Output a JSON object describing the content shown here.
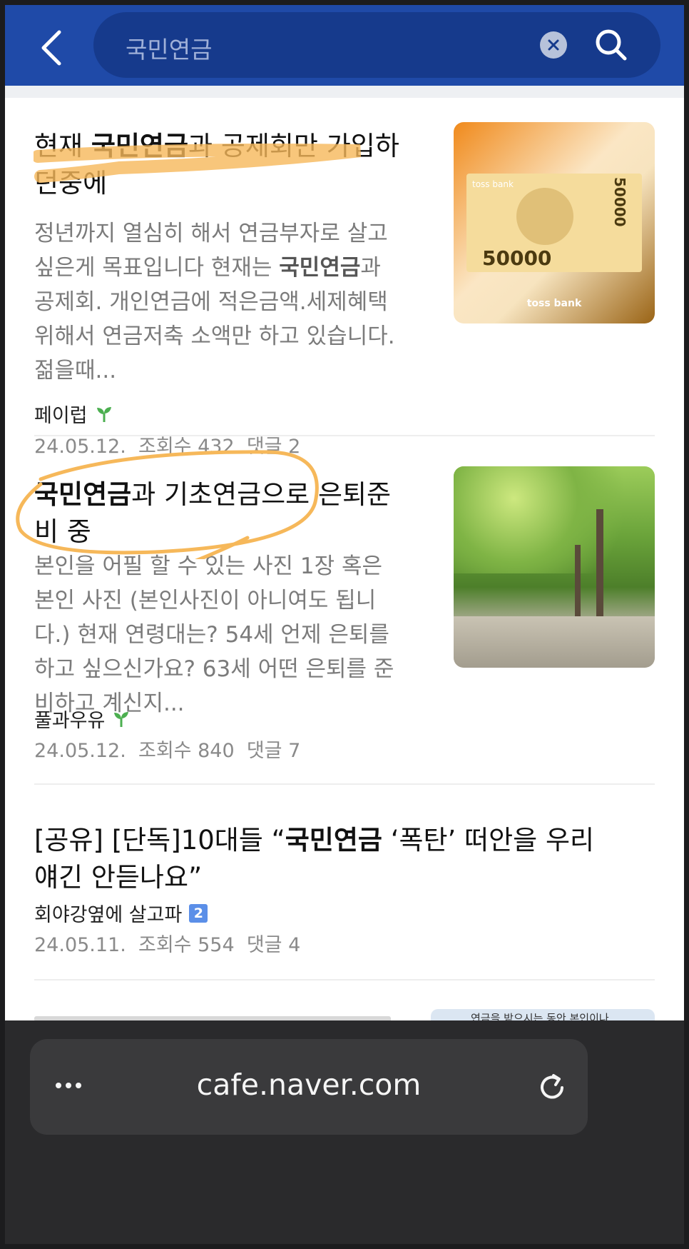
{
  "header": {
    "search_value": "국민연금",
    "back_icon": "chevron-left-icon",
    "clear_icon": "clear-icon",
    "search_icon": "search-icon"
  },
  "articles": [
    {
      "title_bold": "국민연금",
      "title_pre": "현재 ",
      "title_post": "과 공제회만 가입하던중에",
      "snippet_pre": "정년까지 열심히 해서 연금부자로 살고 싶은게 목표입니다 현재는 ",
      "snippet_bold": "국민연금",
      "snippet_post": "과 공제회. 개인연금에 적은금액.세제혜택 위해서 연금저축 소액만 하고 있습니다. 젊을때...",
      "author": "페이럽",
      "date": "24.05.12.",
      "views": "조회수 432",
      "comments": "댓글 2",
      "thumb": {
        "bank_text": "toss bank",
        "amount": "50000",
        "amount_corner": "50000"
      }
    },
    {
      "title_bold": "국민연금",
      "title_post": "과 기초연금으로 은퇴준비 중",
      "snippet": "본인을 어필 할 수 있는 사진 1장 혹은 본인 사진 (본인사진이 아니여도 됩니다.) 현재 연령대는? 54세 언제 은퇴를 하고 싶으신가요? 63세 어떤 은퇴를 준비하고 계신지...",
      "author": "풀과우유",
      "date": "24.05.12.",
      "views": "조회수 840",
      "comments": "댓글 7"
    },
    {
      "title_pre": "[공유] [단독]10대들 “",
      "title_bold": "국민연금",
      "title_post": " ‘폭탄’ 떠안을 우리 얘긴 안듣나요”",
      "author": "회야강옆에 살고파",
      "author_badge": "2",
      "date": "24.05.11.",
      "views": "조회수 554",
      "comments": "댓글 4"
    }
  ],
  "partial_thumb_text": "연금을 받으시는 동안 본인이나",
  "bottom": {
    "url": "cafe.naver.com",
    "more_icon": "more-dots-icon",
    "reload_icon": "reload-icon"
  },
  "colors": {
    "header_bg": "#1f4aa8",
    "search_bg": "#163a8c",
    "annotation": "#f6b85a",
    "sprout": "#4caf50"
  }
}
